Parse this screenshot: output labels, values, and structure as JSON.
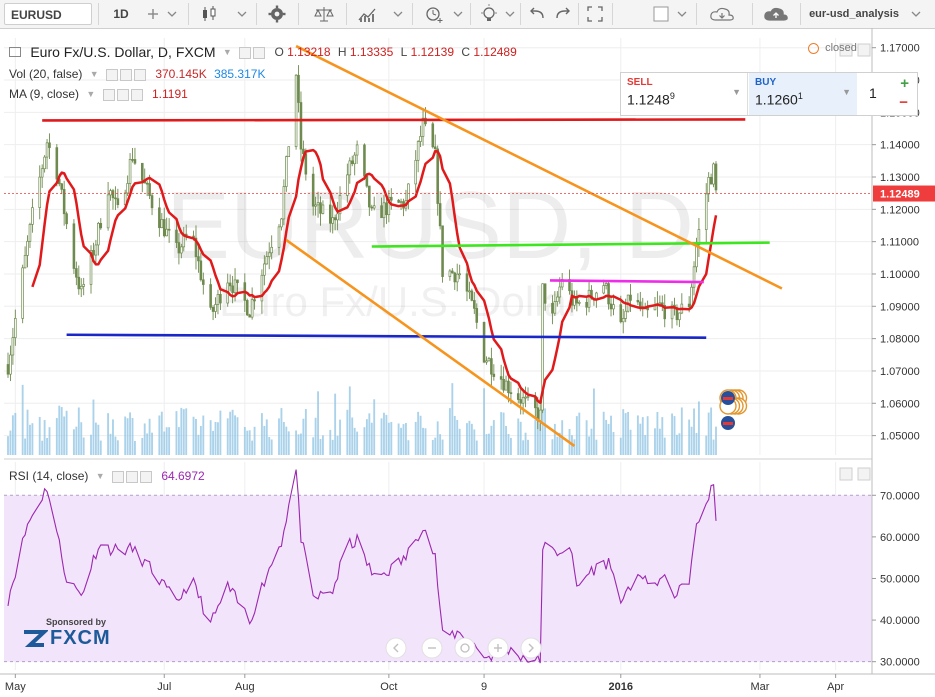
{
  "toolbar": {
    "symbol": "EURUSD",
    "interval": "1D",
    "layout_name": "eur-usd_analysis",
    "icons": [
      "plus-icon",
      "candles-icon",
      "indicators-icon",
      "gear-icon",
      "scales-icon",
      "chart-line-icon",
      "alert-icon",
      "lightbulb-icon",
      "undo-icon",
      "redo-icon",
      "fullscreen-icon",
      "camera-icon",
      "cloud-load-icon",
      "cloud-save-icon"
    ]
  },
  "legend": {
    "main_title": "Euro Fx/U.S. Dollar, D, FXCM",
    "o_label": "O",
    "o_value": "1.13218",
    "h_label": "H",
    "h_value": "1.13335",
    "l_label": "L",
    "l_value": "1.12139",
    "c_label": "C",
    "c_value": "1.12489",
    "vol_title": "Vol (20, false)",
    "vol_value1": "370.145K",
    "vol_value2": "385.317K",
    "ma_title": "MA (9, close)",
    "ma_value": "1.1191",
    "rsi_title": "RSI (14, close)",
    "rsi_value": "64.6972",
    "status": "closed"
  },
  "trade": {
    "sell_label": "SELL",
    "sell_price_main": "1.1248",
    "sell_price_sup": "9",
    "buy_label": "BUY",
    "buy_price_main": "1.1260",
    "buy_price_sup": "1",
    "quantity": "1"
  },
  "watermark": {
    "symbol": "EURUSD, D",
    "description": "Euro Fx/U.S. Dollar"
  },
  "sponsor": {
    "line1": "Sponsored by",
    "brand": "FXCM"
  },
  "colors": {
    "candle_up": "#6e8a4e",
    "candle_down": "#6e8a4e",
    "ma": "#e0191b",
    "volume": "#8ec3e3",
    "rsi": "#9c27b0",
    "rsi_band": "#f1e4fb",
    "resistance": "#e0191b",
    "support": "#1a27c8",
    "channel": "#f7941d",
    "green_line": "#3fe51f",
    "magenta_line": "#ee2de8",
    "price_tag": "#ef3d3d"
  },
  "chart_data": {
    "type": "candlestick",
    "instrument": "EURUSD",
    "timeframe": "D",
    "x_tick_labels": [
      "May",
      "Jul",
      "Aug",
      "Oct",
      "9",
      "2016",
      "Mar",
      "Apr"
    ],
    "x_tick_dates": [
      "2015-05-01",
      "2015-07-01",
      "2015-08-03",
      "2015-10-01",
      "2015-11-09",
      "2016-01-04",
      "2016-03-01",
      "2016-04-01"
    ],
    "price_axis": {
      "ylim": [
        1.044,
        1.173
      ],
      "ticks": [
        "1.17000",
        "1.16000",
        "1.15000",
        "1.14000",
        "1.13000",
        "1.12000",
        "1.11000",
        "1.10000",
        "1.09000",
        "1.08000",
        "1.07000",
        "1.06000",
        "1.05000"
      ],
      "last_price_label": "1.12489"
    },
    "rsi_axis": {
      "ylim": [
        28,
        78
      ],
      "ticks": [
        "70.0000",
        "60.0000",
        "50.0000",
        "40.0000",
        "30.0000"
      ],
      "band": [
        30,
        70
      ]
    },
    "price_anchors": [
      [
        "2015-04-28",
        1.072
      ],
      [
        "2015-05-04",
        1.1
      ],
      [
        "2015-05-08",
        1.118
      ],
      [
        "2015-05-14",
        1.141
      ],
      [
        "2015-05-18",
        1.132
      ],
      [
        "2015-05-25",
        1.103
      ],
      [
        "2015-05-28",
        1.094
      ],
      [
        "2015-06-03",
        1.11
      ],
      [
        "2015-06-08",
        1.127
      ],
      [
        "2015-06-12",
        1.119
      ],
      [
        "2015-06-18",
        1.137
      ],
      [
        "2015-06-22",
        1.129
      ],
      [
        "2015-06-29",
        1.117
      ],
      [
        "2015-07-06",
        1.107
      ],
      [
        "2015-07-12",
        1.113
      ],
      [
        "2015-07-20",
        1.087
      ],
      [
        "2015-07-27",
        1.099
      ],
      [
        "2015-08-05",
        1.089
      ],
      [
        "2015-08-12",
        1.106
      ],
      [
        "2015-08-18",
        1.119
      ],
      [
        "2015-08-24",
        1.162
      ],
      [
        "2015-08-26",
        1.139
      ],
      [
        "2015-08-31",
        1.121
      ],
      [
        "2015-09-08",
        1.116
      ],
      [
        "2015-09-14",
        1.131
      ],
      [
        "2015-09-18",
        1.138
      ],
      [
        "2015-09-24",
        1.118
      ],
      [
        "2015-10-01",
        1.121
      ],
      [
        "2015-10-08",
        1.122
      ],
      [
        "2015-10-15",
        1.146
      ],
      [
        "2015-10-20",
        1.136
      ],
      [
        "2015-10-23",
        1.101
      ],
      [
        "2015-10-30",
        1.1
      ],
      [
        "2015-11-05",
        1.088
      ],
      [
        "2015-11-09",
        1.075
      ],
      [
        "2015-11-18",
        1.066
      ],
      [
        "2015-11-26",
        1.06
      ],
      [
        "2015-12-02",
        1.056
      ],
      [
        "2015-12-03",
        1.095
      ],
      [
        "2015-12-07",
        1.086
      ],
      [
        "2015-12-11",
        1.099
      ],
      [
        "2015-12-16",
        1.09
      ],
      [
        "2015-12-21",
        1.092
      ],
      [
        "2015-12-28",
        1.097
      ],
      [
        "2016-01-04",
        1.083
      ],
      [
        "2016-01-08",
        1.093
      ],
      [
        "2016-01-14",
        1.087
      ],
      [
        "2016-01-20",
        1.09
      ],
      [
        "2016-01-26",
        1.087
      ],
      [
        "2016-02-01",
        1.091
      ],
      [
        "2016-02-04",
        1.109
      ],
      [
        "2016-02-09",
        1.129
      ],
      [
        "2016-02-11",
        1.132
      ],
      [
        "2016-02-12",
        1.125
      ]
    ],
    "ma_period": 9,
    "rsi_anchors": [
      [
        "2015-04-28",
        45
      ],
      [
        "2015-05-06",
        63
      ],
      [
        "2015-05-14",
        72
      ],
      [
        "2015-05-22",
        50
      ],
      [
        "2015-05-28",
        46
      ],
      [
        "2015-06-04",
        58
      ],
      [
        "2015-06-10",
        57
      ],
      [
        "2015-06-18",
        57
      ],
      [
        "2015-06-26",
        52
      ],
      [
        "2015-07-06",
        44
      ],
      [
        "2015-07-12",
        50
      ],
      [
        "2015-07-20",
        39
      ],
      [
        "2015-07-27",
        48
      ],
      [
        "2015-08-05",
        40
      ],
      [
        "2015-08-12",
        51
      ],
      [
        "2015-08-18",
        59
      ],
      [
        "2015-08-24",
        76
      ],
      [
        "2015-08-26",
        60
      ],
      [
        "2015-08-31",
        45
      ],
      [
        "2015-09-08",
        47
      ],
      [
        "2015-09-14",
        58
      ],
      [
        "2015-09-18",
        59
      ],
      [
        "2015-09-25",
        50
      ],
      [
        "2015-10-01",
        52
      ],
      [
        "2015-10-08",
        55
      ],
      [
        "2015-10-15",
        63
      ],
      [
        "2015-10-20",
        55
      ],
      [
        "2015-10-23",
        36
      ],
      [
        "2015-10-30",
        37
      ],
      [
        "2015-11-05",
        34
      ],
      [
        "2015-11-10",
        31
      ],
      [
        "2015-11-18",
        33
      ],
      [
        "2015-11-26",
        31
      ],
      [
        "2015-12-02",
        30
      ],
      [
        "2015-12-03",
        58
      ],
      [
        "2015-12-08",
        56
      ],
      [
        "2015-12-14",
        58
      ],
      [
        "2015-12-17",
        48
      ],
      [
        "2015-12-23",
        52
      ],
      [
        "2015-12-30",
        54
      ],
      [
        "2016-01-05",
        44
      ],
      [
        "2016-01-11",
        52
      ],
      [
        "2016-01-15",
        48
      ],
      [
        "2016-01-21",
        50
      ],
      [
        "2016-01-27",
        46
      ],
      [
        "2016-02-01",
        50
      ],
      [
        "2016-02-04",
        62
      ],
      [
        "2016-02-09",
        70
      ],
      [
        "2016-02-11",
        72
      ],
      [
        "2016-02-12",
        65
      ]
    ],
    "drawings": [
      {
        "name": "resistance-line",
        "color": "#e0191b",
        "from": [
          "2015-05-12",
          1.1475
        ],
        "to": [
          "2016-02-24",
          1.1478
        ]
      },
      {
        "name": "support-line",
        "color": "#1a27c8",
        "from": [
          "2015-05-22",
          1.0812
        ],
        "to": [
          "2016-02-08",
          1.0803
        ]
      },
      {
        "name": "green-line",
        "color": "#3fe51f",
        "from": [
          "2015-09-24",
          1.1085
        ],
        "to": [
          "2016-03-05",
          1.1097
        ]
      },
      {
        "name": "magenta-line",
        "color": "#ee2de8",
        "from": [
          "2015-12-06",
          1.098
        ],
        "to": [
          "2016-02-07",
          1.0975
        ]
      },
      {
        "name": "channel-upper",
        "color": "#f7941d",
        "from": [
          "2015-08-24",
          1.1705
        ],
        "to": [
          "2016-03-10",
          1.0955
        ]
      },
      {
        "name": "channel-lower",
        "color": "#f7941d",
        "from": [
          "2015-08-20",
          1.1105
        ],
        "to": [
          "2015-12-16",
          1.0468
        ]
      }
    ],
    "grid": true
  }
}
